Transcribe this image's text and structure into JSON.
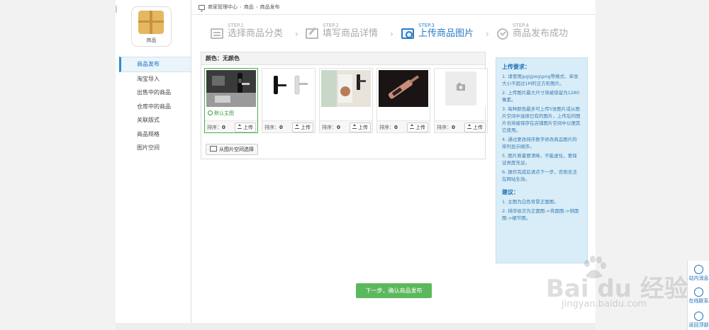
{
  "sidebar": {
    "logo_label": "商品",
    "items": [
      {
        "label": "商品发布",
        "active": true
      },
      {
        "label": "淘宝导入"
      },
      {
        "label": "出售中的商品"
      },
      {
        "label": "仓库中的商品"
      },
      {
        "label": "关联版式"
      },
      {
        "label": "商品规格"
      },
      {
        "label": "图片空间"
      }
    ]
  },
  "breadcrumb": {
    "home": "商家管理中心",
    "level1": "商品",
    "level2": "商品发布",
    "sep": "›"
  },
  "steps": [
    {
      "no": "STEP.1",
      "name": "选择商品分类",
      "icon": "list-icon"
    },
    {
      "no": "STEP.2",
      "name": "填写商品详情",
      "icon": "edit-icon"
    },
    {
      "no": "STEP.3",
      "name": "上传商品图片",
      "icon": "image-icon",
      "active": true
    },
    {
      "no": "STEP.4",
      "name": "商品发布成功",
      "icon": "check-circle-icon"
    }
  ],
  "step_arrow": "›",
  "color_panel": {
    "title": "颜色：无颜色",
    "default_tag": "默认主图",
    "order_label": "排序：",
    "upload_label": "上传",
    "thumbs": [
      {
        "order": "0",
        "image": "door-lock-bathroom-photo",
        "is_main": true
      },
      {
        "order": "0",
        "image": "door-lock-black-silver-photo"
      },
      {
        "order": "0",
        "image": "door-lock-room-photo"
      },
      {
        "order": "0",
        "image": "door-lock-rose-gold-photo"
      },
      {
        "order": "0",
        "image": "placeholder-camera-icon"
      }
    ],
    "pick_button": "从图片空间选择"
  },
  "requirements": {
    "title": "上传要求：",
    "items": [
      "1. 请使用jpg\\jpeg\\png等格式、单张大小不超过1M的正方形图片。",
      "2. 上传图片最大尺寸将被保留为1280像素。",
      "3. 每种颜色最多可上传5张图片或从图片空间中选择已有的图片，上传后的图片也将被保存在店铺图片空间中以便其它使用。",
      "4. 通过更改排序数字修改商品图片的排列显示顺序。",
      "5. 图片质量要清晰，不能虚化，要保证亮度充足。",
      "6. 操作完成后请点下一步，否则无法在网站生效。"
    ],
    "suggest_title": "建议：",
    "suggestions": [
      "1. 主图为白色背景正面图。",
      "2. 排序依次为正面图->背面图->侧面图->细节图。"
    ]
  },
  "next_button": "下一步，确认商品发布",
  "float_bar": {
    "message": "站内消息",
    "service": "在线联系",
    "top": "返回顶部"
  },
  "watermark": {
    "main": "Bai du 经验",
    "sub": "jingyan.baidu.com"
  },
  "colors": {
    "accent": "#2a7bc8",
    "success": "#5cb85c",
    "req_bg": "#d8edf8"
  }
}
